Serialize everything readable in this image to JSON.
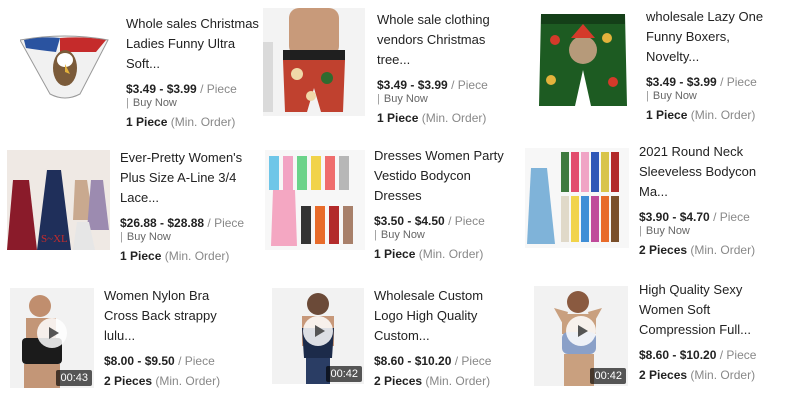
{
  "products": [
    {
      "title": "Whole sales Christmas Ladies Funny Ultra Soft...",
      "price": "$3.49 - $3.99",
      "unit": "/ Piece",
      "buy": "Buy Now",
      "moq_qty": "1 Piece",
      "moq_label": "(Min. Order)",
      "video": false,
      "duration": ""
    },
    {
      "title": "Whole sale clothing vendors Christmas tree...",
      "price": "$3.49 - $3.99",
      "unit": "/ Piece",
      "buy": "Buy Now",
      "moq_qty": "1 Piece",
      "moq_label": "(Min. Order)",
      "video": false,
      "duration": ""
    },
    {
      "title": "wholesale Lazy One Funny Boxers, Novelty...",
      "price": "$3.49 - $3.99",
      "unit": "/ Piece",
      "buy": "Buy Now",
      "moq_qty": "1 Piece",
      "moq_label": "(Min. Order)",
      "video": false,
      "duration": ""
    },
    {
      "title": "Ever-Pretty Women's Plus Size A-Line 3/4 Lace...",
      "price": "$26.88 - $28.88",
      "unit": "/ Piece",
      "buy": "Buy Now",
      "moq_qty": "1 Piece",
      "moq_label": "(Min. Order)",
      "video": false,
      "duration": ""
    },
    {
      "title": "Dresses Women Party Vestido Bodycon Dresses",
      "price": "$3.50 - $4.50",
      "unit": "/ Piece",
      "buy": "Buy Now",
      "moq_qty": "1 Piece",
      "moq_label": "(Min. Order)",
      "video": false,
      "duration": ""
    },
    {
      "title": "2021 Round Neck Sleeveless Bodycon Ma...",
      "price": "$3.90 - $4.70",
      "unit": "/ Piece",
      "buy": "Buy Now",
      "moq_qty": "2 Pieces",
      "moq_label": "(Min. Order)",
      "video": false,
      "duration": ""
    },
    {
      "title": "Women Nylon Bra Cross Back strappy lulu...",
      "price": "$8.00 - $9.50",
      "unit": "/ Piece",
      "buy": "",
      "moq_qty": "2 Pieces",
      "moq_label": "(Min. Order)",
      "video": true,
      "duration": "00:43"
    },
    {
      "title": "Wholesale Custom Logo High Quality Custom...",
      "price": "$8.60 - $10.20",
      "unit": "/ Piece",
      "buy": "",
      "moq_qty": "2 Pieces",
      "moq_label": "(Min. Order)",
      "video": true,
      "duration": "00:42"
    },
    {
      "title": "High Quality Sexy Women Soft Compression Full...",
      "price": "$8.60 - $10.20",
      "unit": "/ Piece",
      "buy": "",
      "moq_qty": "2 Pieces",
      "moq_label": "(Min. Order)",
      "video": true,
      "duration": "00:42"
    }
  ],
  "colors": {
    "thumb_bg": "#f3f3f3",
    "accent": "#222222"
  }
}
